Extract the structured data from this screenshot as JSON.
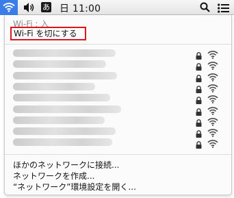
{
  "menubar": {
    "ime_label": "あ",
    "clock": "日 11:00",
    "wifi_active_color": "#3a7ce8"
  },
  "wifi_menu": {
    "status": "Wi-Fi : 入",
    "toggle_label": "Wi-Fi を切にする",
    "networks": [
      {
        "name": "",
        "locked": true,
        "signal": "full"
      },
      {
        "name": "",
        "locked": true,
        "signal": "full"
      },
      {
        "name": "",
        "locked": true,
        "signal": "full"
      },
      {
        "name": "",
        "locked": true,
        "signal": "full"
      },
      {
        "name": "",
        "locked": true,
        "signal": "full"
      },
      {
        "name": "",
        "locked": true,
        "signal": "full"
      },
      {
        "name": "",
        "locked": true,
        "signal": "full"
      },
      {
        "name": "",
        "locked": true,
        "signal": "full"
      },
      {
        "name": "",
        "locked": true,
        "signal": "full"
      }
    ],
    "actions": [
      "ほかのネットワークに接続...",
      "ネットワークを作成...",
      "“ネットワーク”環境設定を開く..."
    ]
  }
}
